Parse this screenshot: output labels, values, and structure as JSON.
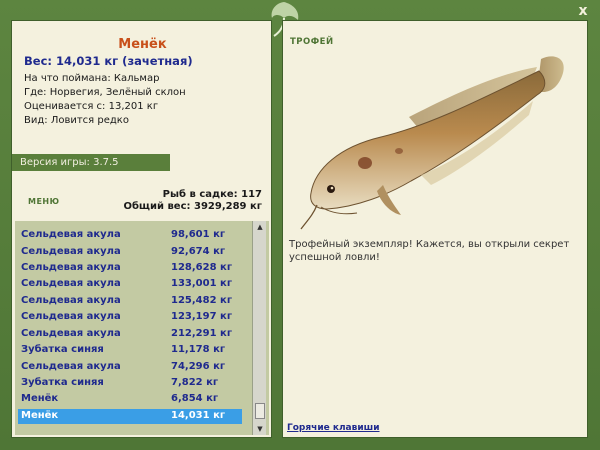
{
  "window": {
    "close_label": "x"
  },
  "fish": {
    "name": "Менёк",
    "weight": "Вес: 14,031 кг (зачетная)",
    "bait": "На что поймана: Кальмар",
    "place": "Где: Норвегия, Зелёный склон",
    "valued": "Оценивается с: 13,201 кг",
    "kind": "Вид: Ловится редко"
  },
  "version": "Версия игры: 3.7.5",
  "menu_label": "МЕНЮ",
  "stats": {
    "count": "Рыб в садке: 117",
    "total": "Общий вес: 3929,289 кг"
  },
  "catch_list": [
    {
      "name": "Сельдевая акула",
      "weight": "98,601 кг"
    },
    {
      "name": "Сельдевая акула",
      "weight": "92,674 кг"
    },
    {
      "name": "Сельдевая акула",
      "weight": "128,628 кг"
    },
    {
      "name": "Сельдевая акула",
      "weight": "133,001 кг"
    },
    {
      "name": "Сельдевая акула",
      "weight": "125,482 кг"
    },
    {
      "name": "Сельдевая акула",
      "weight": "123,197 кг"
    },
    {
      "name": "Сельдевая акула",
      "weight": "212,291 кг"
    },
    {
      "name": "Зубатка синяя",
      "weight": "11,178 кг"
    },
    {
      "name": "Сельдевая акула",
      "weight": "74,296 кг"
    },
    {
      "name": "Зубатка синяя",
      "weight": "7,822 кг"
    },
    {
      "name": "Менёк",
      "weight": "6,854 кг"
    },
    {
      "name": "Менёк",
      "weight": "14,031 кг",
      "selected": true
    }
  ],
  "trophy": {
    "label": "ТРОФЕЙ",
    "text": "Трофейный экземпляр! Кажется, вы открыли секрет успешной ловли!"
  },
  "hotkeys_label": "Горячие клавиши",
  "colors": {
    "frame": "#5c7f3e",
    "panel": "#f4f1de",
    "title": "#c8501a",
    "link": "#1f2a8e",
    "selected": "#3a9ee6"
  }
}
